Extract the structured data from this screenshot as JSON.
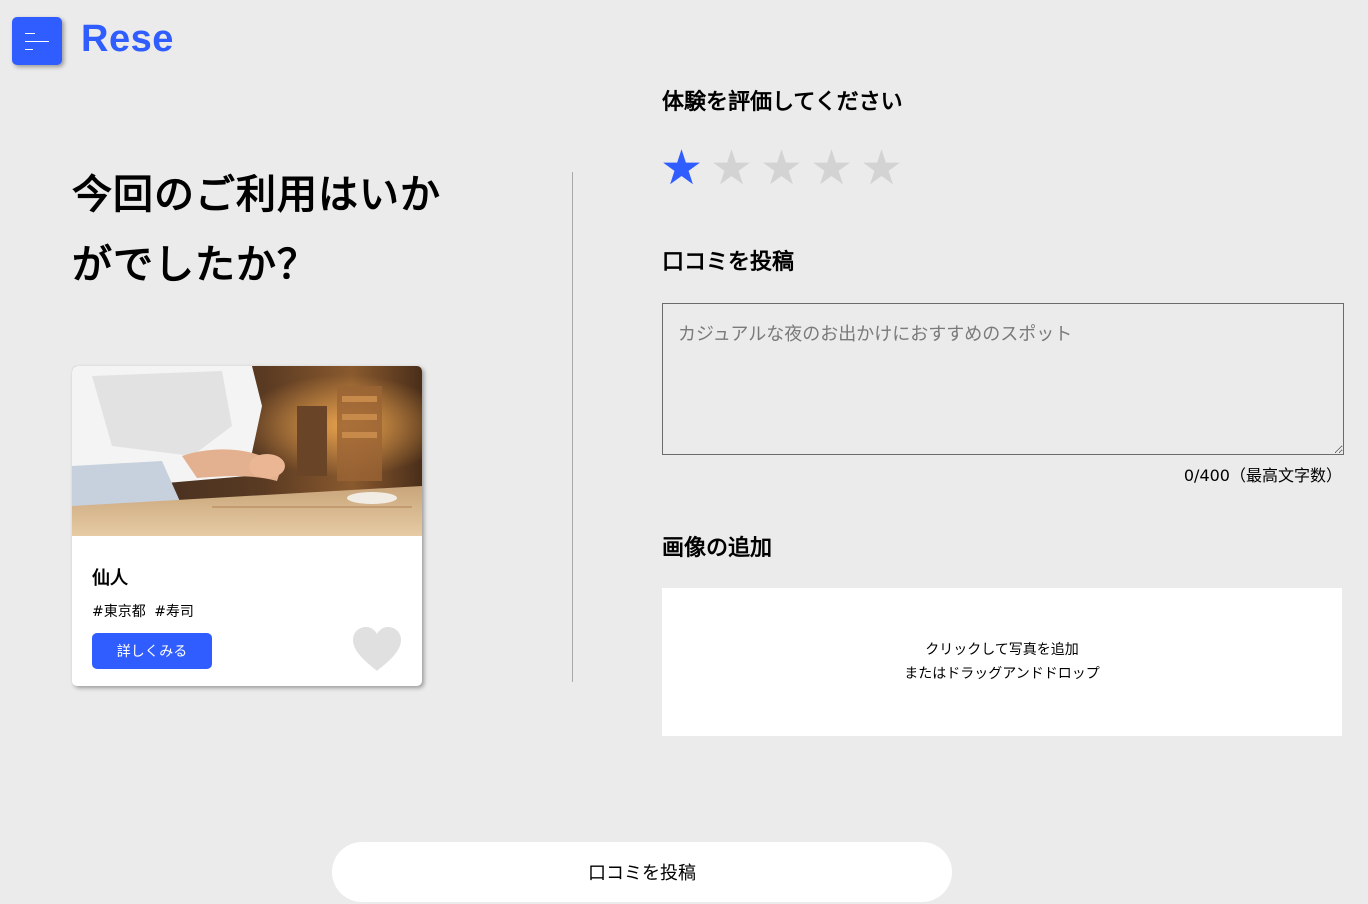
{
  "header": {
    "logo": "Rese",
    "menu_icon": "menu-icon",
    "brand_color": "#305dff"
  },
  "main": {
    "heading": "今回のご利用はいかがでしたか？"
  },
  "shop_card": {
    "name": "仙人",
    "tags": [
      "#東京都",
      "#寿司"
    ],
    "detail_button": "詳しくみる",
    "favorite_icon": "heart-icon"
  },
  "rating": {
    "title": "体験を評価してください",
    "value": 1,
    "max": 5,
    "filled_color": "#305dff",
    "empty_color": "#d3d3d3"
  },
  "review": {
    "title": "口コミを投稿",
    "placeholder": "カジュアルな夜のお出かけにおすすめのスポット",
    "value": "",
    "char_count": "0/400（最高文字数）"
  },
  "image_upload": {
    "title": "画像の追加",
    "line1": "クリックして写真を追加",
    "line2": "またはドラッグアンドドロップ"
  },
  "submit_button": "口コミを投稿"
}
